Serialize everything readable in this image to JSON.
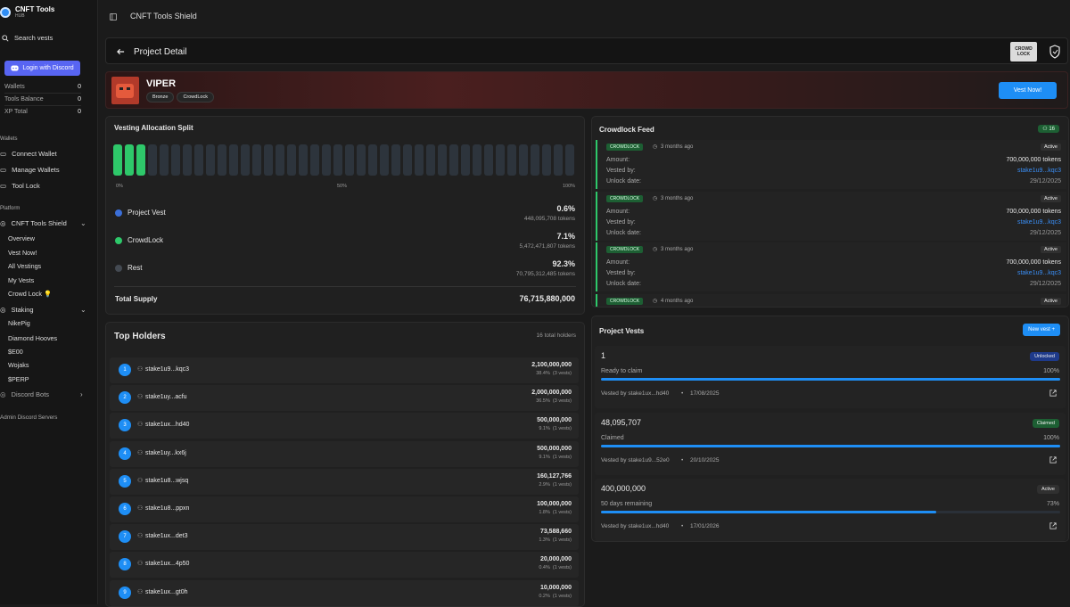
{
  "sidebar": {
    "app_name": "CNFT Tools",
    "app_sub": "HUB",
    "search_label": "Search vests",
    "login_label": "Login with Discord",
    "stats": [
      {
        "label": "Wallets",
        "value": "0"
      },
      {
        "label": "Tools Balance",
        "value": "0"
      },
      {
        "label": "XP Total",
        "value": "0"
      }
    ],
    "wallets_section": "Wallets",
    "wallet_items": [
      "Connect Wallet",
      "Manage Wallets",
      "Tool Lock"
    ],
    "platform_section": "Platform",
    "shield_label": "CNFT Tools Shield",
    "shield_items": [
      "Overview",
      "Vest Now!",
      "All Vestings",
      "My Vests",
      "Crowd Lock"
    ],
    "staking_label": "Staking",
    "staking_items": [
      "NikePig",
      "Diamond Hooves",
      "$E00",
      "Wojaks",
      "$PERP"
    ],
    "discord_bots": "Discord Bots",
    "admin_label": "Admin Discord Servers"
  },
  "topbar": {
    "title": "CNFT Tools Shield"
  },
  "header": {
    "title": "Project Detail",
    "logo_text": "CROWD LOCK"
  },
  "project": {
    "name": "VIPER",
    "tags": [
      "Bronze",
      "CrowdLock"
    ],
    "vest_button": "Vest Now!"
  },
  "allocation": {
    "title": "Vesting Allocation Split",
    "scale": [
      "0%",
      "50%",
      "100%"
    ],
    "filled_bars": 3,
    "total_bars": 40,
    "rows": [
      {
        "name": "Project Vest",
        "pct": "0.6%",
        "tokens": "448,095,708 tokens",
        "color": "#3b6fd8"
      },
      {
        "name": "CrowdLock",
        "pct": "7.1%",
        "tokens": "5,472,471,807 tokens",
        "color": "#2ec86a"
      },
      {
        "name": "Rest",
        "pct": "92.3%",
        "tokens": "70,795,312,485 tokens",
        "color": "#444a52"
      }
    ],
    "total_label": "Total Supply",
    "total_value": "76,715,880,000"
  },
  "holders": {
    "title": "Top Holders",
    "count": "16 total holders",
    "rows": [
      {
        "rank": "1",
        "addr": "stake1u9...kqc3",
        "amount": "2,100,000,000",
        "meta": "38.4%  (3 vests)"
      },
      {
        "rank": "2",
        "addr": "stake1uy...acfu",
        "amount": "2,000,000,000",
        "meta": "36.5%  (3 vests)"
      },
      {
        "rank": "3",
        "addr": "stake1ux...hd40",
        "amount": "500,000,000",
        "meta": "9.1%  (1 vests)"
      },
      {
        "rank": "4",
        "addr": "stake1uy...kx6j",
        "amount": "500,000,000",
        "meta": "9.1%  (1 vests)"
      },
      {
        "rank": "5",
        "addr": "stake1u8...wjsq",
        "amount": "160,127,766",
        "meta": "2.9%  (1 vests)"
      },
      {
        "rank": "6",
        "addr": "stake1u8...ppxn",
        "amount": "100,000,000",
        "meta": "1.8%  (1 vests)"
      },
      {
        "rank": "7",
        "addr": "stake1ux...det3",
        "amount": "73,588,660",
        "meta": "1.3%  (1 vests)"
      },
      {
        "rank": "8",
        "addr": "stake1ux...4p50",
        "amount": "20,000,000",
        "meta": "0.4%  (1 vests)"
      },
      {
        "rank": "9",
        "addr": "stake1ux...gt0h",
        "amount": "10,000,000",
        "meta": "0.2%  (1 vests)"
      }
    ]
  },
  "feed": {
    "title": "Crowdlock Feed",
    "count": "16",
    "items": [
      {
        "tag": "CROWDLOCK",
        "time": "3 months ago",
        "status": "Active",
        "amount_label": "Amount:",
        "amount": "700,000,000 tokens",
        "vested_label": "Vested by:",
        "vested": "stake1u9...kqc3",
        "unlock_label": "Unlock date:",
        "unlock": "29/12/2025"
      },
      {
        "tag": "CROWDLOCK",
        "time": "3 months ago",
        "status": "Active",
        "amount_label": "Amount:",
        "amount": "700,000,000 tokens",
        "vested_label": "Vested by:",
        "vested": "stake1u9...kqc3",
        "unlock_label": "Unlock date:",
        "unlock": "29/12/2025"
      },
      {
        "tag": "CROWDLOCK",
        "time": "3 months ago",
        "status": "Active",
        "amount_label": "Amount:",
        "amount": "700,000,000 tokens",
        "vested_label": "Vested by:",
        "vested": "stake1u9...kqc3",
        "unlock_label": "Unlock date:",
        "unlock": "29/12/2025"
      },
      {
        "tag": "CROWDLOCK",
        "time": "4 months ago",
        "status": "Active"
      }
    ]
  },
  "vests": {
    "title": "Project Vests",
    "new_button": "New vest +",
    "items": [
      {
        "amount": "1",
        "status": "Unlocked",
        "status_color": "#1e3a8a",
        "label": "Ready to claim",
        "pct": "100%",
        "progress": 1.0,
        "by": "Vested by stake1ux...hd40",
        "sep": "•",
        "date": "17/08/2025"
      },
      {
        "amount": "48,095,707",
        "status": "Claimed",
        "status_color": "#1d5f33",
        "label": "Claimed",
        "pct": "100%",
        "progress": 1.0,
        "by": "Vested by stake1u9...52e0",
        "sep": "•",
        "date": "20/10/2025"
      },
      {
        "amount": "400,000,000",
        "status": "Active",
        "status_color": "#303030",
        "label": "50 days remaining",
        "pct": "73%",
        "progress": 0.73,
        "by": "Vested by stake1ux...hd40",
        "sep": "•",
        "date": "17/01/2026"
      }
    ]
  }
}
